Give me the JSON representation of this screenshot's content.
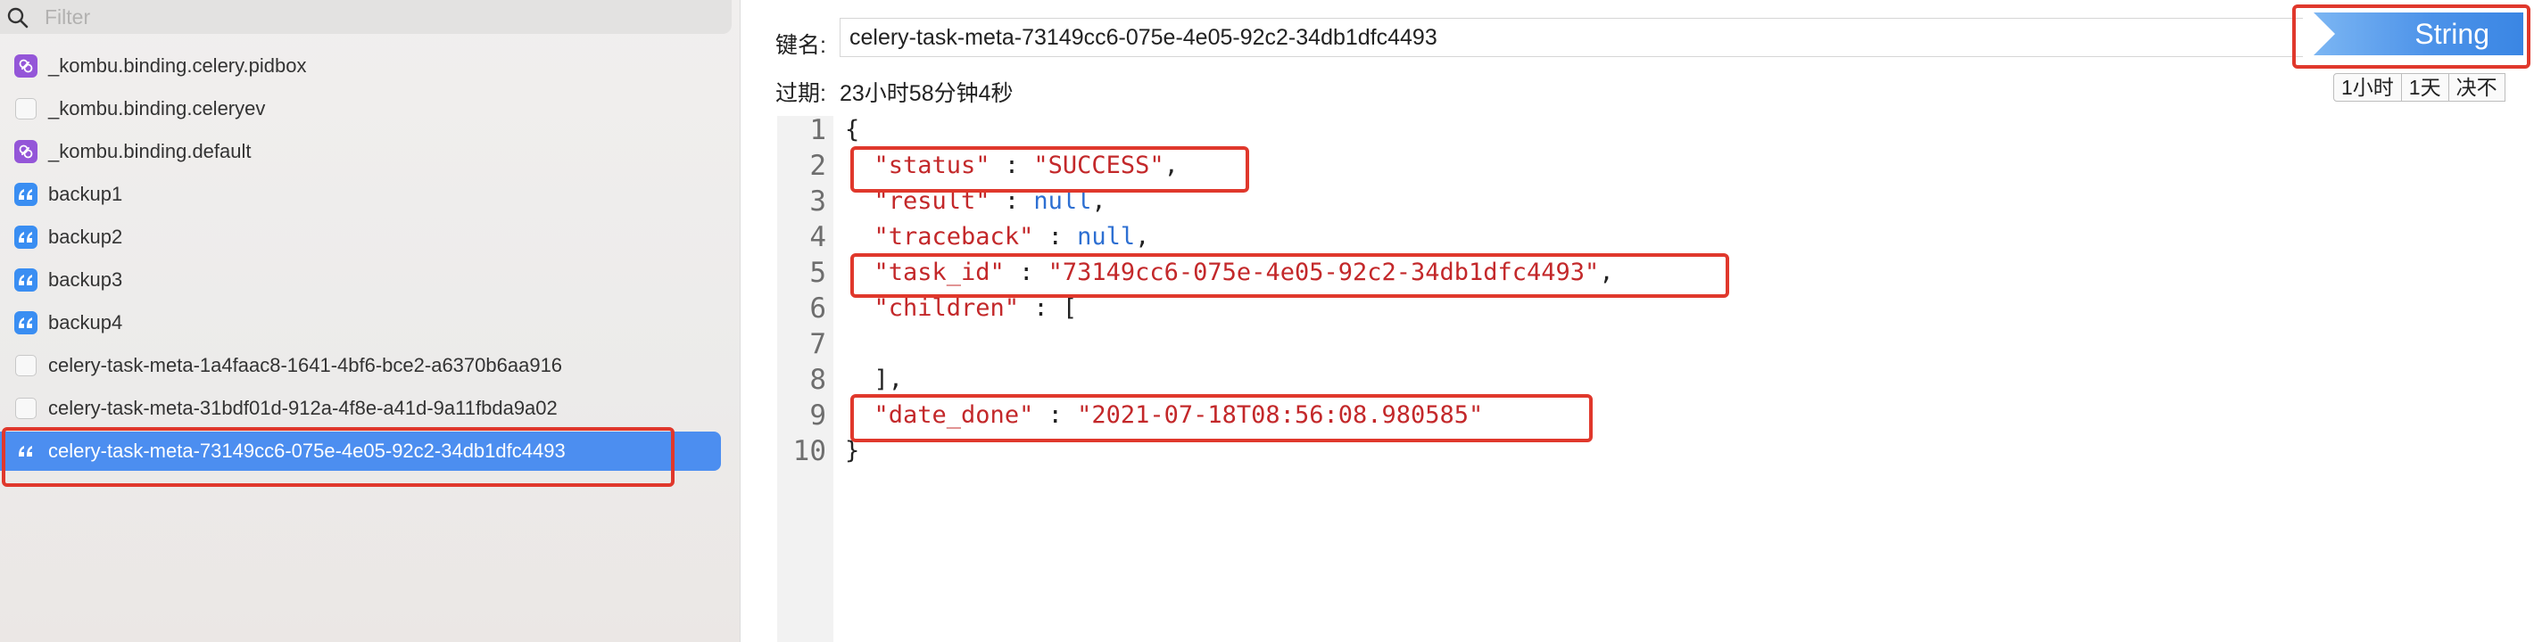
{
  "sidebar": {
    "filter_placeholder": "Filter",
    "items": [
      {
        "name": "_kombu.binding.celery.pidbox",
        "type": "set",
        "selected": false
      },
      {
        "name": "_kombu.binding.celeryev",
        "type": "none",
        "selected": false
      },
      {
        "name": "_kombu.binding.default",
        "type": "set",
        "selected": false
      },
      {
        "name": "backup1",
        "type": "string",
        "selected": false
      },
      {
        "name": "backup2",
        "type": "string",
        "selected": false
      },
      {
        "name": "backup3",
        "type": "string",
        "selected": false
      },
      {
        "name": "backup4",
        "type": "string",
        "selected": false
      },
      {
        "name": "celery-task-meta-1a4faac8-1641-4bf6-bce2-a6370b6aa916",
        "type": "none",
        "selected": false
      },
      {
        "name": "celery-task-meta-31bdf01d-912a-4f8e-a41d-9a11fbda9a02",
        "type": "none",
        "selected": false
      },
      {
        "name": "celery-task-meta-73149cc6-075e-4e05-92c2-34db1dfc4493",
        "type": "string",
        "selected": true
      }
    ]
  },
  "detail": {
    "key_label": "键名:",
    "key_value": "celery-task-meta-73149cc6-075e-4e05-92c2-34db1dfc4493",
    "type_badge": "String",
    "ttl_label": "过期:",
    "ttl_value": "23小时58分钟4秒",
    "ttl_buttons": [
      "1小时",
      "1天",
      "决不"
    ]
  },
  "editor": {
    "line_numbers": [
      "1",
      "2",
      "3",
      "4",
      "5",
      "6",
      "7",
      "8",
      "9",
      "10"
    ],
    "lines": [
      {
        "t": [
          [
            "pun",
            "{"
          ]
        ]
      },
      {
        "t": [
          [
            "pun",
            "  "
          ],
          [
            "key",
            "\"status\""
          ],
          [
            "pun",
            " : "
          ],
          [
            "str",
            "\"SUCCESS\""
          ],
          [
            "pun",
            ","
          ]
        ]
      },
      {
        "t": [
          [
            "pun",
            "  "
          ],
          [
            "key",
            "\"result\""
          ],
          [
            "pun",
            " : "
          ],
          [
            "null",
            "null"
          ],
          [
            "pun",
            ","
          ]
        ]
      },
      {
        "t": [
          [
            "pun",
            "  "
          ],
          [
            "key",
            "\"traceback\""
          ],
          [
            "pun",
            " : "
          ],
          [
            "null",
            "null"
          ],
          [
            "pun",
            ","
          ]
        ]
      },
      {
        "t": [
          [
            "pun",
            "  "
          ],
          [
            "key",
            "\"task_id\""
          ],
          [
            "pun",
            " : "
          ],
          [
            "str",
            "\"73149cc6-075e-4e05-92c2-34db1dfc4493\""
          ],
          [
            "pun",
            ","
          ]
        ]
      },
      {
        "t": [
          [
            "pun",
            "  "
          ],
          [
            "key",
            "\"children\""
          ],
          [
            "pun",
            " : ["
          ]
        ]
      },
      {
        "t": [
          [
            "pun",
            ""
          ]
        ]
      },
      {
        "t": [
          [
            "pun",
            "  ],"
          ]
        ]
      },
      {
        "t": [
          [
            "pun",
            "  "
          ],
          [
            "key",
            "\"date_done\""
          ],
          [
            "pun",
            " : "
          ],
          [
            "str",
            "\"2021-07-18T08:56:08.980585\""
          ]
        ]
      },
      {
        "t": [
          [
            "pun",
            "}"
          ]
        ]
      }
    ]
  },
  "colors": {
    "selection": "#4c8ef0",
    "annotation": "#e0382c",
    "json_key": "#c3282a",
    "json_null": "#2d6fd2"
  }
}
